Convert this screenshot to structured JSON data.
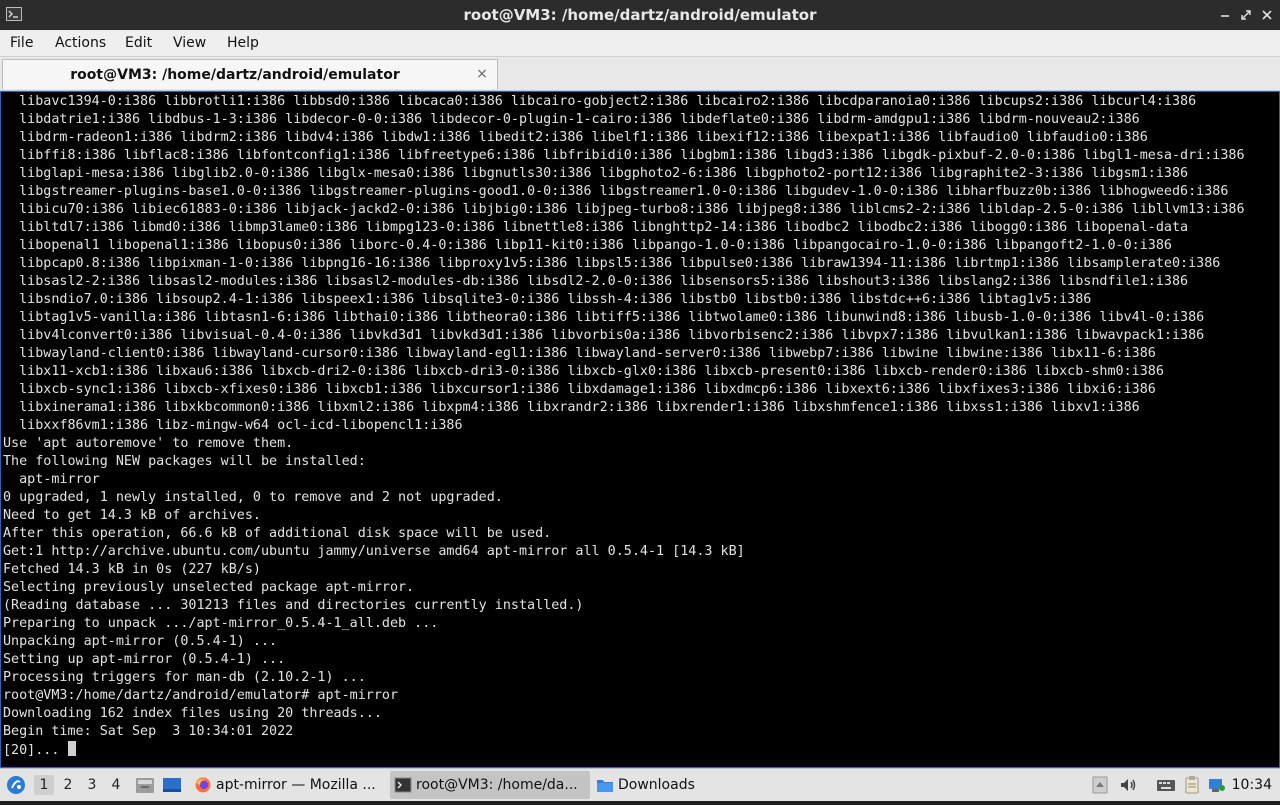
{
  "window": {
    "title": "root@VM3: /home/dartz/android/emulator",
    "controls": [
      "minimize-icon",
      "maximize-icon",
      "close-icon"
    ]
  },
  "menu": [
    "File",
    "Actions",
    "Edit",
    "View",
    "Help"
  ],
  "tab": {
    "label": "root@VM3: /home/dartz/android/emulator",
    "close": "×"
  },
  "terminal": {
    "lines": [
      "  libavc1394-0:i386 libbrotli1:i386 libbsd0:i386 libcaca0:i386 libcairo-gobject2:i386 libcairo2:i386 libcdparanoia0:i386 libcups2:i386 libcurl4:i386",
      "  libdatrie1:i386 libdbus-1-3:i386 libdecor-0-0:i386 libdecor-0-plugin-1-cairo:i386 libdeflate0:i386 libdrm-amdgpu1:i386 libdrm-nouveau2:i386",
      "  libdrm-radeon1:i386 libdrm2:i386 libdv4:i386 libdw1:i386 libedit2:i386 libelf1:i386 libexif12:i386 libexpat1:i386 libfaudio0 libfaudio0:i386",
      "  libffi8:i386 libflac8:i386 libfontconfig1:i386 libfreetype6:i386 libfribidi0:i386 libgbm1:i386 libgd3:i386 libgdk-pixbuf-2.0-0:i386 libgl1-mesa-dri:i386",
      "  libglapi-mesa:i386 libglib2.0-0:i386 libglx-mesa0:i386 libgnutls30:i386 libgphoto2-6:i386 libgphoto2-port12:i386 libgraphite2-3:i386 libgsm1:i386",
      "  libgstreamer-plugins-base1.0-0:i386 libgstreamer-plugins-good1.0-0:i386 libgstreamer1.0-0:i386 libgudev-1.0-0:i386 libharfbuzz0b:i386 libhogweed6:i386",
      "  libicu70:i386 libiec61883-0:i386 libjack-jackd2-0:i386 libjbig0:i386 libjpeg-turbo8:i386 libjpeg8:i386 liblcms2-2:i386 libldap-2.5-0:i386 libllvm13:i386",
      "  libltdl7:i386 libmd0:i386 libmp3lame0:i386 libmpg123-0:i386 libnettle8:i386 libnghttp2-14:i386 libodbc2 libodbc2:i386 libogg0:i386 libopenal-data",
      "  libopenal1 libopenal1:i386 libopus0:i386 liborc-0.4-0:i386 libp11-kit0:i386 libpango-1.0-0:i386 libpangocairo-1.0-0:i386 libpangoft2-1.0-0:i386",
      "  libpcap0.8:i386 libpixman-1-0:i386 libpng16-16:i386 libproxy1v5:i386 libpsl5:i386 libpulse0:i386 libraw1394-11:i386 librtmp1:i386 libsamplerate0:i386",
      "  libsasl2-2:i386 libsasl2-modules:i386 libsasl2-modules-db:i386 libsdl2-2.0-0:i386 libsensors5:i386 libshout3:i386 libslang2:i386 libsndfile1:i386",
      "  libsndio7.0:i386 libsoup2.4-1:i386 libspeex1:i386 libsqlite3-0:i386 libssh-4:i386 libstb0 libstb0:i386 libstdc++6:i386 libtag1v5:i386",
      "  libtag1v5-vanilla:i386 libtasn1-6:i386 libthai0:i386 libtheora0:i386 libtiff5:i386 libtwolame0:i386 libunwind8:i386 libusb-1.0-0:i386 libv4l-0:i386",
      "  libv4lconvert0:i386 libvisual-0.4-0:i386 libvkd3d1 libvkd3d1:i386 libvorbis0a:i386 libvorbisenc2:i386 libvpx7:i386 libvulkan1:i386 libwavpack1:i386",
      "  libwayland-client0:i386 libwayland-cursor0:i386 libwayland-egl1:i386 libwayland-server0:i386 libwebp7:i386 libwine libwine:i386 libx11-6:i386",
      "  libx11-xcb1:i386 libxau6:i386 libxcb-dri2-0:i386 libxcb-dri3-0:i386 libxcb-glx0:i386 libxcb-present0:i386 libxcb-render0:i386 libxcb-shm0:i386",
      "  libxcb-sync1:i386 libxcb-xfixes0:i386 libxcb1:i386 libxcursor1:i386 libxdamage1:i386 libxdmcp6:i386 libxext6:i386 libxfixes3:i386 libxi6:i386",
      "  libxinerama1:i386 libxkbcommon0:i386 libxml2:i386 libxpm4:i386 libxrandr2:i386 libxrender1:i386 libxshmfence1:i386 libxss1:i386 libxv1:i386",
      "  libxxf86vm1:i386 libz-mingw-w64 ocl-icd-libopencl1:i386",
      "Use 'apt autoremove' to remove them.",
      "The following NEW packages will be installed:",
      "  apt-mirror",
      "0 upgraded, 1 newly installed, 0 to remove and 2 not upgraded.",
      "Need to get 14.3 kB of archives.",
      "After this operation, 66.6 kB of additional disk space will be used.",
      "Get:1 http://archive.ubuntu.com/ubuntu jammy/universe amd64 apt-mirror all 0.5.4-1 [14.3 kB]",
      "Fetched 14.3 kB in 0s (227 kB/s)",
      "Selecting previously unselected package apt-mirror.",
      "(Reading database ... 301213 files and directories currently installed.)",
      "Preparing to unpack .../apt-mirror_0.5.4-1_all.deb ...",
      "Unpacking apt-mirror (0.5.4-1) ...",
      "Setting up apt-mirror (0.5.4-1) ...",
      "Processing triggers for man-db (2.10.2-1) ...",
      "root@VM3:/home/dartz/android/emulator# apt-mirror",
      "Downloading 162 index files using 20 threads...",
      "Begin time: Sat Sep  3 10:34:01 2022",
      "[20]... "
    ]
  },
  "taskbar": {
    "workspaces": [
      "1",
      "2",
      "3",
      "4"
    ],
    "active_workspace": "1",
    "tasks": [
      {
        "label": "apt-mirror — Mozilla ...",
        "icon": "firefox-icon"
      },
      {
        "label": "root@VM3: /home/da...",
        "icon": "terminal-icon"
      },
      {
        "label": "Downloads",
        "icon": "folder-icon"
      }
    ],
    "clock": "10:34"
  }
}
